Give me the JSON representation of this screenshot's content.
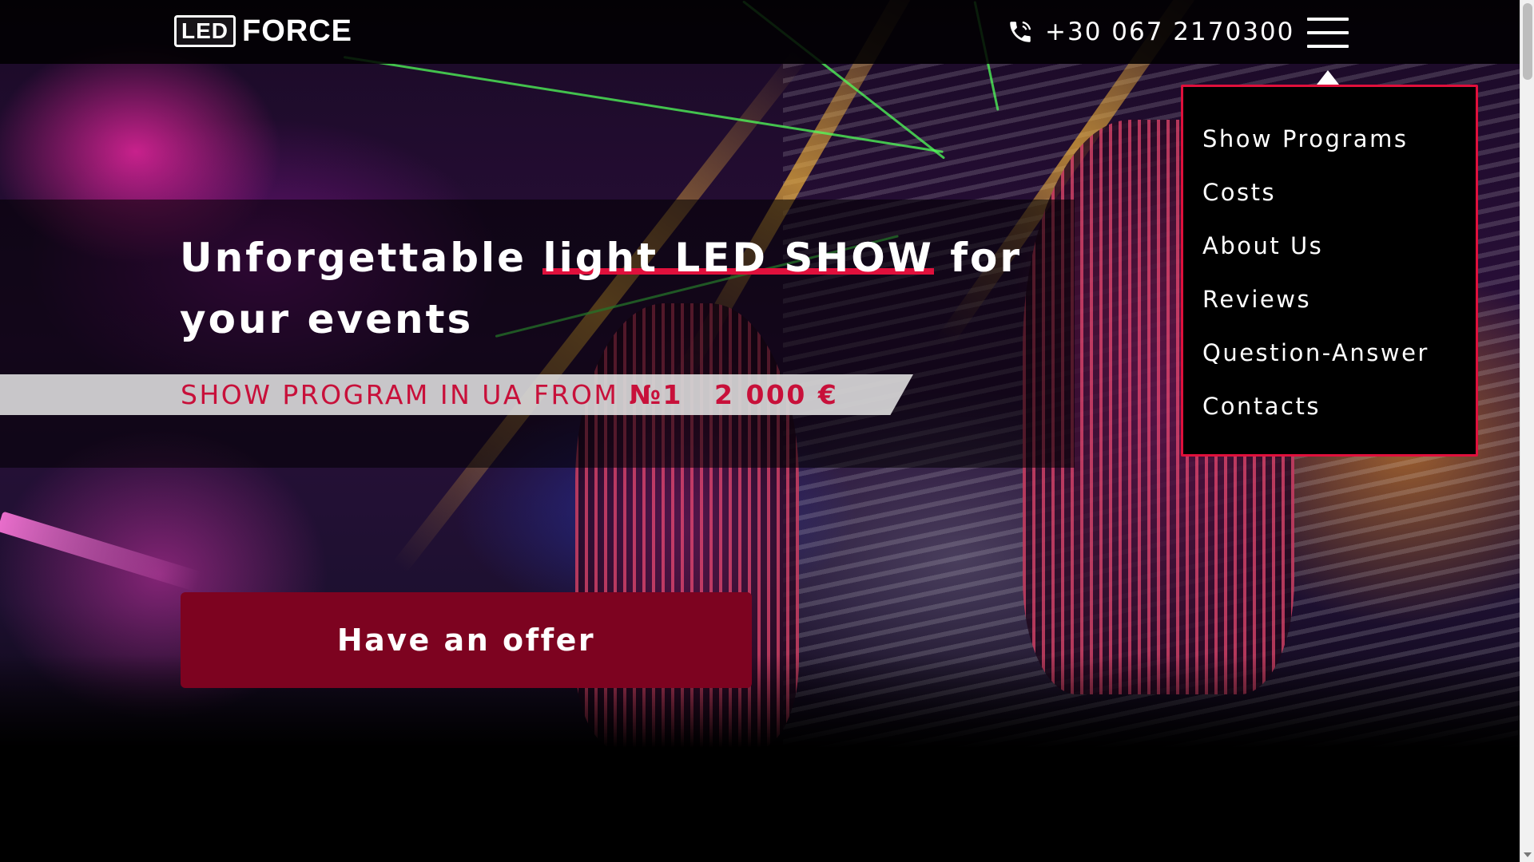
{
  "header": {
    "logo_box": "LED",
    "logo_text": "FORCE",
    "phone_number": "+30 067 2170300"
  },
  "menu": {
    "items": [
      {
        "label": "Show Programs"
      },
      {
        "label": "Costs"
      },
      {
        "label": "About Us"
      },
      {
        "label": "Reviews"
      },
      {
        "label": "Question-Answer"
      },
      {
        "label": "Contacts"
      }
    ]
  },
  "hero": {
    "headline_before": "Unforgettable ",
    "headline_highlight": "light LED SHOW",
    "headline_after": " for your events",
    "tagline_prefix": "SHOW PROGRAM IN UA FROM ",
    "tagline_rank": "№1",
    "tagline_price": "2 000 €",
    "cta_label": "Have an offer"
  },
  "colors": {
    "accent": "#e0103c",
    "cta_background": "#7d0320",
    "tagline_text": "#c8103a",
    "header_background": "#000000"
  },
  "icons": {
    "phone": "phone-icon",
    "menu": "hamburger-icon"
  }
}
